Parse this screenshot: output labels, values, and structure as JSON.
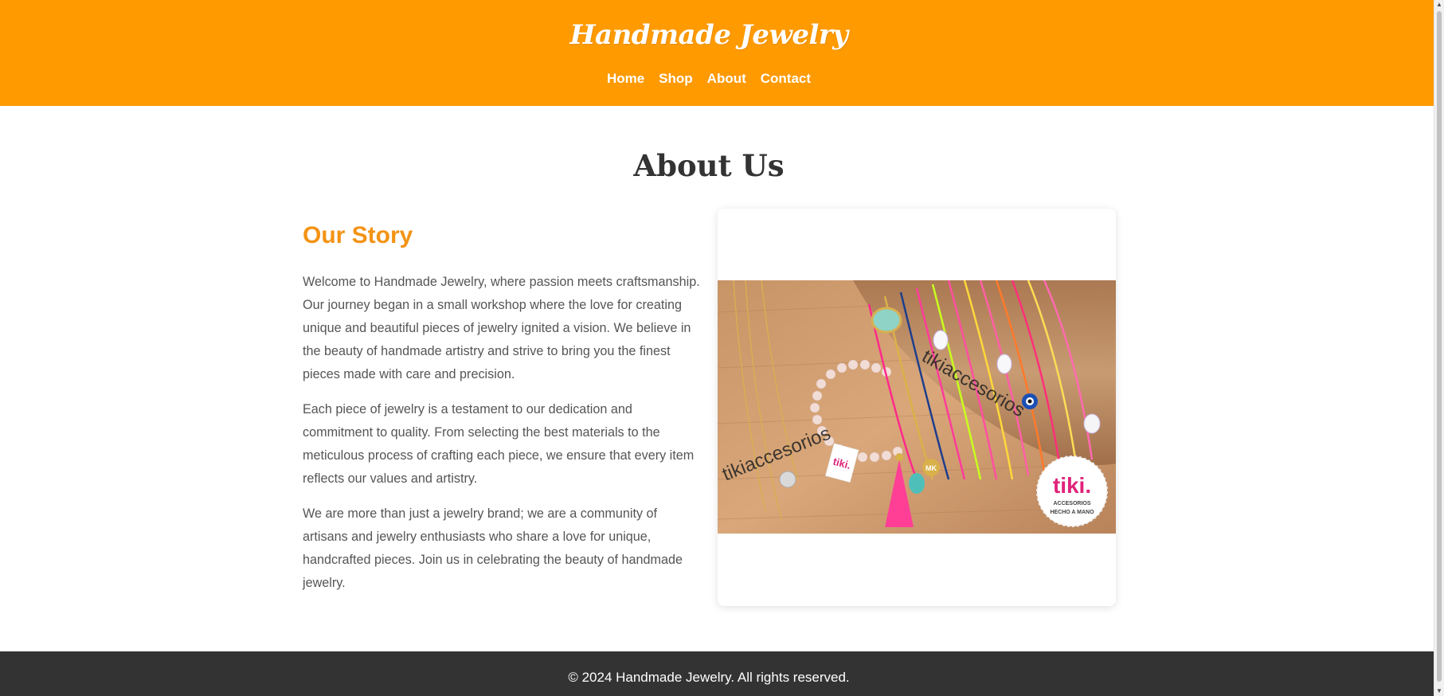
{
  "header": {
    "brand": "Handmade Jewelry",
    "nav": [
      "Home",
      "Shop",
      "About",
      "Contact"
    ],
    "background_color": "#ff9a00"
  },
  "main": {
    "title": "About Us",
    "story": {
      "heading": "Our Story",
      "paragraphs": [
        "Welcome to Handmade Jewelry, where passion meets craftsmanship. Our journey began in a small workshop where the love for creating unique and beautiful pieces of jewelry ignited a vision. We believe in the beauty of handmade artistry and strive to bring you the finest pieces made with care and precision.",
        "Each piece of jewelry is a testament to our dedication and commitment to quality. From selecting the best materials to the meticulous process of crafting each piece, we ensure that every item reflects our values and artistry.",
        "We are more than just a jewelry brand; we are a community of artisans and jewelry enthusiasts who share a love for unique, handcrafted pieces. Join us in celebrating the beauty of handmade jewelry."
      ],
      "heading_color": "#f39314"
    },
    "image": {
      "watermark": "tikiaccesorios",
      "logo_text": "tiki.",
      "logo_subtitle_1": "ACCESORIOS",
      "logo_subtitle_2": "HECHO A MANO",
      "tag_text": "tiki.",
      "pendant_text": "MK"
    }
  },
  "footer": {
    "copyright": "© 2024 Handmade Jewelry. All rights reserved.",
    "background_color": "#333333"
  }
}
